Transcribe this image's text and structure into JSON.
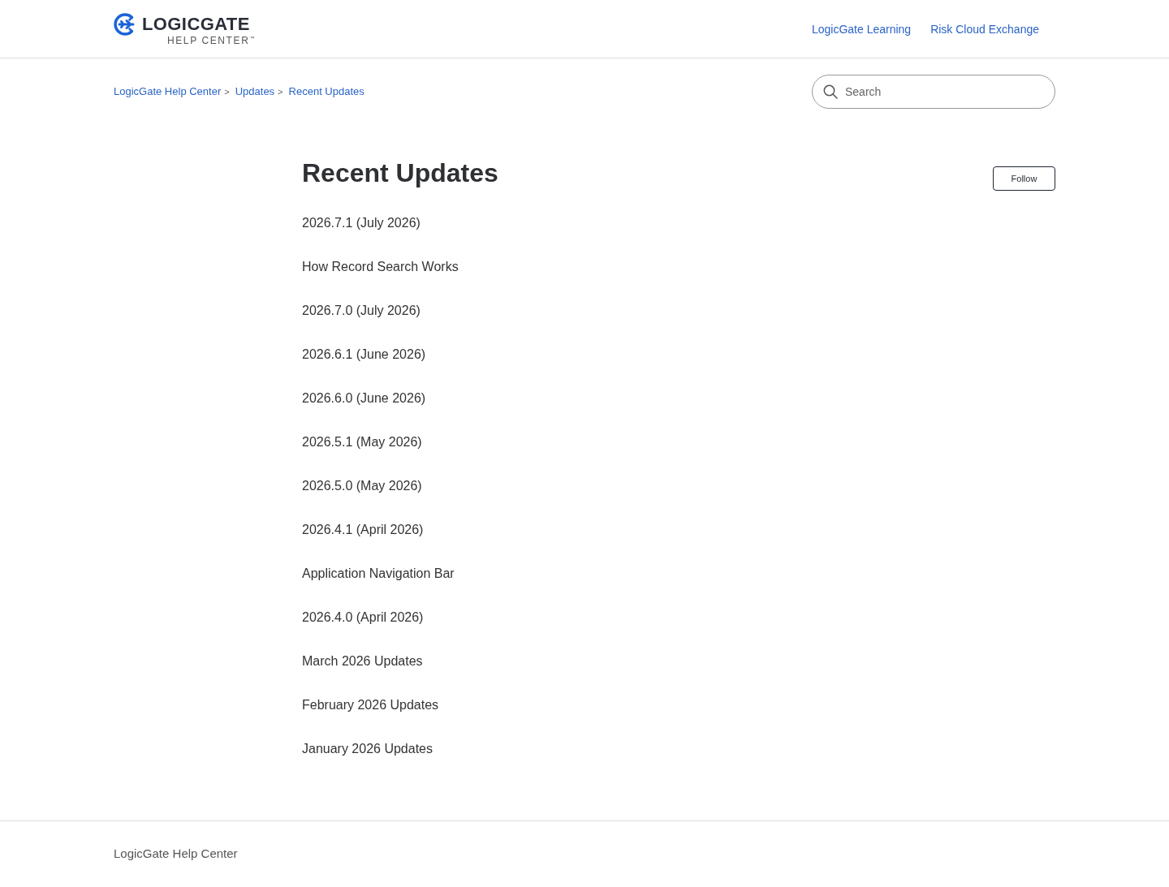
{
  "header": {
    "logo": {
      "wordmark": "LOGICGATE",
      "subtitle": "HELP CENTER$^{™}$"
    },
    "nav_links": [
      "LogicGate Learning",
      "Risk Cloud Exchange"
    ]
  },
  "breadcrumbs": [
    {
      "label": "LogicGate Help Center",
      "separator": ">"
    },
    {
      "label": "Updates",
      "separator": ">"
    },
    {
      "label": "Recent Updates"
    }
  ],
  "search": {
    "placeholder": "Search"
  },
  "section": {
    "title": "Recent Updates",
    "follow_button": "Follow",
    "articles": [
      "2026.7.1 (July 2026)",
      "How Record Search Works",
      "2026.7.0 (July 2026)",
      "2026.6.1 (June 2026)",
      "2026.6.0 (June 2026)",
      "2026.5.1 (May 2026)",
      "2026.5.0 (May 2026)",
      "2026.4.1 (April 2026)",
      "Application Navigation Bar",
      "2026.4.0 (April 2026)",
      "March 2026 Updates",
      "February 2026 Updates",
      "January 2026 Updates"
    ]
  },
  "footer": {
    "text": "LogicGate Help Center"
  }
}
